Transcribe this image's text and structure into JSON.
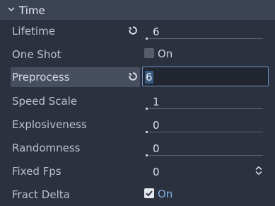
{
  "section": {
    "title": "Time",
    "expanded": true
  },
  "properties": {
    "lifetime": {
      "label": "Lifetime",
      "value": "6",
      "modified": true
    },
    "one_shot": {
      "label": "One Shot",
      "checkbox_label": "On",
      "checked": false
    },
    "preprocess": {
      "label": "Preprocess",
      "value": "6",
      "modified": true,
      "editing": true
    },
    "speed_scale": {
      "label": "Speed Scale",
      "value": "1"
    },
    "explosiveness": {
      "label": "Explosiveness",
      "value": "0"
    },
    "randomness": {
      "label": "Randomness",
      "value": "0"
    },
    "fixed_fps": {
      "label": "Fixed Fps",
      "value": "0"
    },
    "fract_delta": {
      "label": "Fract Delta",
      "checkbox_label": "On",
      "checked": true
    }
  },
  "icons": {
    "section_toggle": "chevron-down-icon",
    "revert": "revert-icon",
    "spinner": "spinner-arrows-icon",
    "checkmark": "checkmark-icon"
  },
  "colors": {
    "background": "#2c3140",
    "header": "#3b4253",
    "selected_row": "#474e60",
    "accent": "#83aee4",
    "edit_border": "#6f95c3"
  }
}
